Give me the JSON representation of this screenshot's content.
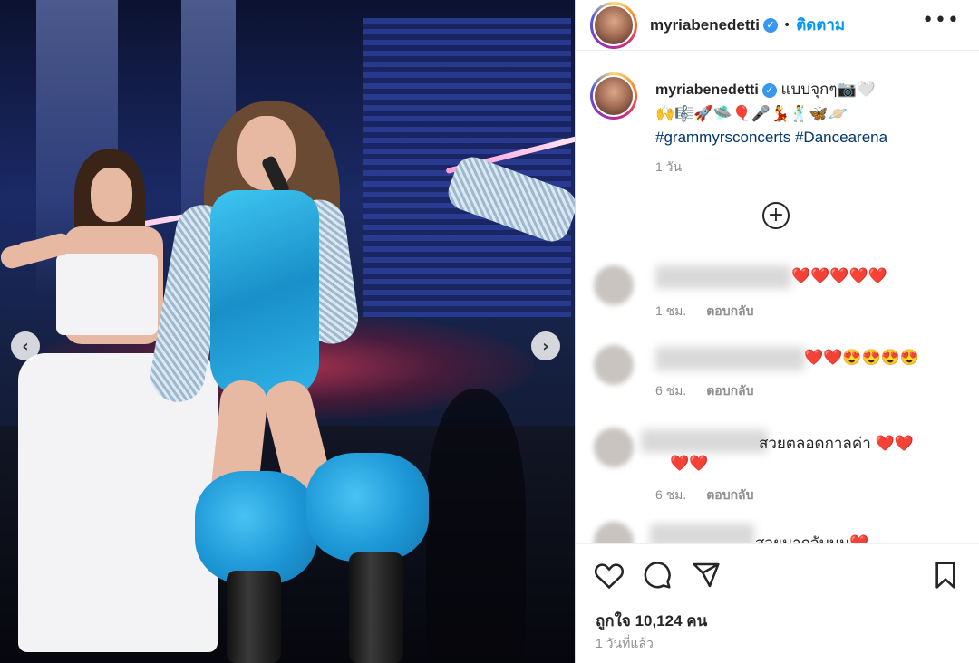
{
  "post": {
    "username": "myriabenedetti",
    "follow_label": "ติดตาม",
    "dot": "•",
    "more_label": "•••",
    "caption_text": "แบบจุกๆ📷🤍",
    "caption_emojis": "🙌🎼🚀🛸🎈🎤💃🕺🦋🪐",
    "hashtags": "#grammyrsconcerts #Dancearena",
    "caption_time": "1 วัน",
    "likes": "ถูกใจ 10,124 คน",
    "posted_ago": "1 วันที่แล้ว",
    "prev_arrow": "‹",
    "next_arrow": "›",
    "load_more": "+"
  },
  "comments": [
    {
      "text": "❤️❤️❤️❤️❤️",
      "time": "1 ชม.",
      "reply": "ตอบกลับ"
    },
    {
      "text": "❤️❤️😍😍😍😍",
      "time": "6 ชม.",
      "reply": "ตอบกลับ"
    },
    {
      "text": "สวยตลอดกาลค่า ❤️❤️",
      "text2": "❤️❤️",
      "time": "6 ชม.",
      "reply": "ตอบกลับ"
    },
    {
      "text": "สวยมากจับมม❤️"
    }
  ],
  "icons": {
    "verified": "verified-badge-icon",
    "like": "heart-icon",
    "comment": "comment-icon",
    "share": "paper-plane-icon",
    "save": "bookmark-icon"
  },
  "colors": {
    "accent": "#0095f6",
    "verified": "#3897f0",
    "heart": "#ed2f3a",
    "muted": "#8e8e8e"
  }
}
